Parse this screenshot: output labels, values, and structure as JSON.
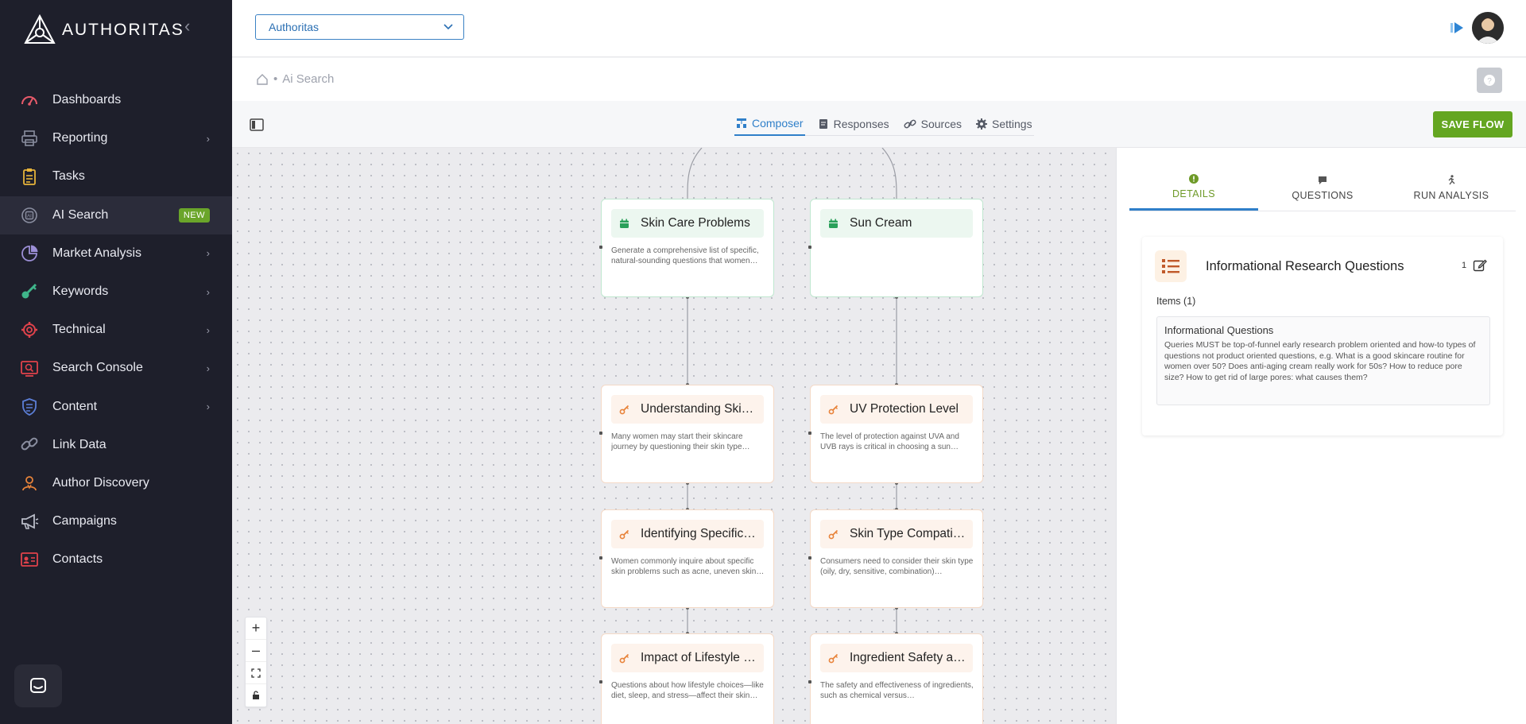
{
  "app": {
    "brand": "AUTHORITAS"
  },
  "sidebar": {
    "items": [
      {
        "label": "Dashboards",
        "icon": "gauge-icon",
        "color": "#e85a6a",
        "has_chevron": false
      },
      {
        "label": "Reporting",
        "icon": "printer-icon",
        "color": "#8a8ea0",
        "has_chevron": true
      },
      {
        "label": "Tasks",
        "icon": "clipboard-icon",
        "color": "#e7b43a",
        "has_chevron": false
      },
      {
        "label": "AI Search",
        "icon": "ai-chip-icon",
        "color": "#8a8ea0",
        "has_chevron": false,
        "badge": "NEW",
        "active": true
      },
      {
        "label": "Market Analysis",
        "icon": "pie-chart-icon",
        "color": "#9c8fd6",
        "has_chevron": true
      },
      {
        "label": "Keywords",
        "icon": "key-icon",
        "color": "#3fb58a",
        "has_chevron": true
      },
      {
        "label": "Technical",
        "icon": "gear-icon",
        "color": "#e0424b",
        "has_chevron": true
      },
      {
        "label": "Search Console",
        "icon": "search-console-icon",
        "color": "#e0424b",
        "has_chevron": true
      },
      {
        "label": "Content",
        "icon": "shield-icon",
        "color": "#5c7fd8",
        "has_chevron": true
      },
      {
        "label": "Link Data",
        "icon": "link-icon",
        "color": "#8a8ea0",
        "has_chevron": false
      },
      {
        "label": "Author Discovery",
        "icon": "author-icon",
        "color": "#e8833a",
        "has_chevron": false
      },
      {
        "label": "Campaigns",
        "icon": "megaphone-icon",
        "color": "#b9bcc8",
        "has_chevron": false
      },
      {
        "label": "Contacts",
        "icon": "contact-card-icon",
        "color": "#e0424b",
        "has_chevron": false
      }
    ]
  },
  "topbar": {
    "org_selected": "Authoritas"
  },
  "breadcrumb": {
    "current": "Ai Search"
  },
  "tabs": {
    "composer": "Composer",
    "responses": "Responses",
    "sources": "Sources",
    "settings": "Settings",
    "active": "Composer"
  },
  "toolbar": {
    "save_label": "SAVE FLOW"
  },
  "canvas": {
    "nodes": [
      {
        "kind": "category",
        "title": "Skin Care Problems",
        "description": "Generate a comprehensive list of specific, natural-sounding questions that women…"
      },
      {
        "kind": "category",
        "title": "Sun Cream",
        "description": ""
      },
      {
        "kind": "item",
        "title": "Understanding Ski…",
        "description": "Many women may start their skincare journey by questioning their skin type…"
      },
      {
        "kind": "item",
        "title": "UV Protection Level",
        "description": "The level of protection against UVA and UVB rays is critical in choosing a sun…"
      },
      {
        "kind": "item",
        "title": "Identifying Specific…",
        "description": "Women commonly inquire about specific skin problems such as acne, uneven skin…"
      },
      {
        "kind": "item",
        "title": "Skin Type Compati…",
        "description": "Consumers need to consider their skin type (oily, dry, sensitive, combination)…"
      },
      {
        "kind": "item",
        "title": "Impact of Lifestyle …",
        "description": "Questions about how lifestyle choices—like diet, sleep, and stress—affect their skin ca…"
      },
      {
        "kind": "item",
        "title": "Ingredient Safety a…",
        "description": "The safety and effectiveness of ingredients, such as chemical versus…"
      }
    ]
  },
  "right_panel": {
    "tabs": {
      "details": "DETAILS",
      "questions": "QUESTIONS",
      "run_analysis": "RUN ANALYSIS",
      "active": "DETAILS"
    },
    "card": {
      "title": "Informational Research Questions",
      "count": "1",
      "items_label": "Items (1)",
      "question_title": "Informational Questions",
      "question_text": "Queries MUST be top-of-funnel early research problem oriented and how-to types of questions not product oriented questions, e.g. What is a good skincare routine for women over 50? Does anti-aging cream really work for 50s? How to reduce pore size? How to get rid of large pores: what causes them?"
    }
  },
  "colors": {
    "accent": "#2f7fc9",
    "save": "#64a621",
    "sidebar_bg": "#1e1f2b"
  }
}
